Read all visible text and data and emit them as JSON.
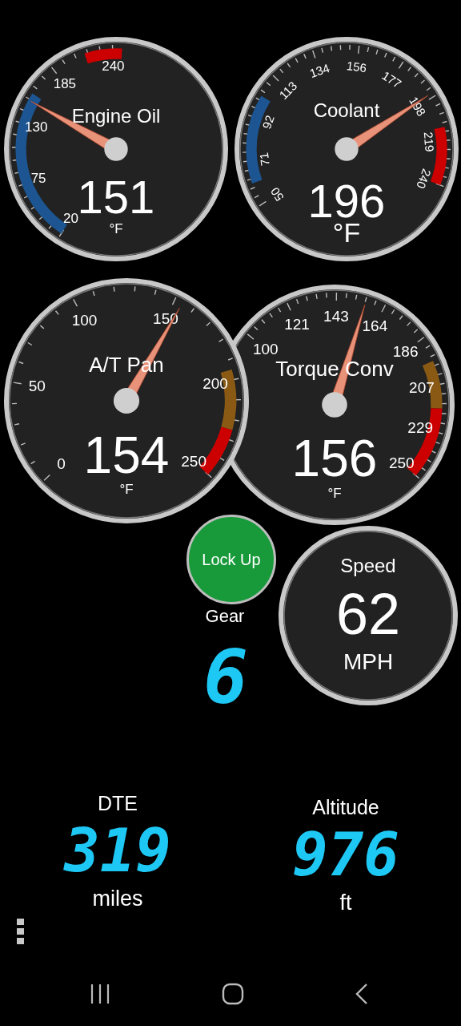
{
  "gauges": [
    {
      "title": "Engine Oil",
      "value": "151",
      "unit": "°F",
      "ticks": [
        {
          "label": "20"
        },
        {
          "label": "75"
        },
        {
          "label": "130"
        },
        {
          "label": "185"
        },
        {
          "label": "240"
        }
      ]
    },
    {
      "title": "Coolant",
      "value": "196",
      "unit": "°F",
      "ticks": [
        {
          "label": "50"
        },
        {
          "label": "71"
        },
        {
          "label": "92"
        },
        {
          "label": "113"
        },
        {
          "label": "134"
        },
        {
          "label": "156"
        },
        {
          "label": "177"
        },
        {
          "label": "198"
        },
        {
          "label": "219"
        },
        {
          "label": "240"
        }
      ]
    },
    {
      "title": "A/T Pan",
      "value": "154",
      "unit": "°F",
      "ticks": [
        {
          "label": "0"
        },
        {
          "label": "50"
        },
        {
          "label": "100"
        },
        {
          "label": "150"
        },
        {
          "label": "200"
        },
        {
          "label": "250"
        }
      ]
    },
    {
      "title": "Torque Conv",
      "value": "156",
      "unit": "°F",
      "ticks": [
        {
          "label": "100"
        },
        {
          "label": "121"
        },
        {
          "label": "143"
        },
        {
          "label": "164"
        },
        {
          "label": "186"
        },
        {
          "label": "207"
        },
        {
          "label": "229"
        },
        {
          "label": "250"
        }
      ]
    }
  ],
  "lock_up": {
    "label": "Lock Up",
    "on": true
  },
  "gear": {
    "label": "Gear",
    "value": "6"
  },
  "speed": {
    "title": "Speed",
    "value": "62",
    "unit": "MPH"
  },
  "readouts": [
    {
      "label": "DTE",
      "value": "319",
      "unit": "miles"
    },
    {
      "label": "Altitude",
      "value": "976",
      "unit": "ft"
    }
  ]
}
